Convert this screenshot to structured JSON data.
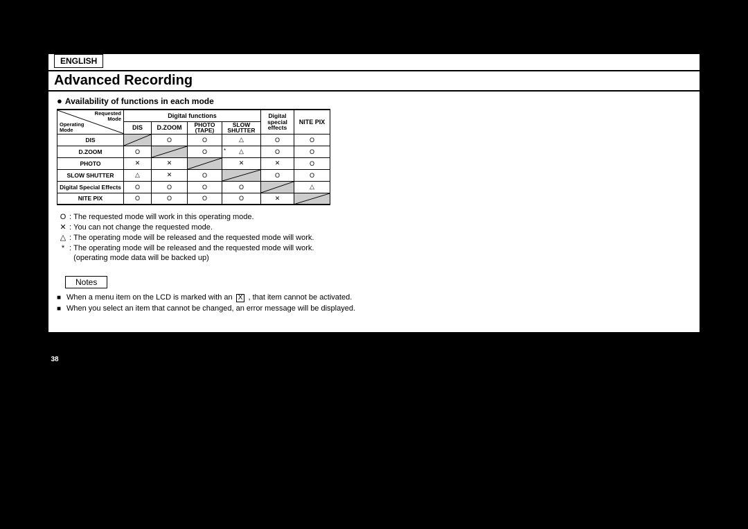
{
  "lang": "ENGLISH",
  "title": "Advanced Recording",
  "subhead": "Availability of functions in each mode",
  "table": {
    "diag": {
      "topRight": "Requested\nMode",
      "bottomLeft": "Operating\nMode"
    },
    "groupDigital": "Digital functions",
    "cols": {
      "dis": "DIS",
      "dzoom": "D.ZOOM",
      "photo1": "PHOTO",
      "photo2": "(TAPE)",
      "slow1": "SLOW",
      "slow2": "SHUTTER",
      "dse1": "Digital",
      "dse2": "special",
      "dse3": "effects",
      "nite": "NITE PIX"
    },
    "rowLabels": [
      "DIS",
      "D.ZOOM",
      "PHOTO",
      "SLOW SHUTTER",
      "Digital Special Effects",
      "NITE PIX"
    ]
  },
  "chart_data": {
    "type": "table",
    "title": "Availability of functions in each mode",
    "columns": [
      "DIS",
      "D.ZOOM",
      "PHOTO (TAPE)",
      "SLOW SHUTTER",
      "Digital special effects",
      "NITE PIX"
    ],
    "rows": [
      "DIS",
      "D.ZOOM",
      "PHOTO",
      "SLOW SHUTTER",
      "Digital Special Effects",
      "NITE PIX"
    ],
    "values": [
      [
        "self",
        "O",
        "O",
        "△",
        "O",
        "O"
      ],
      [
        "O",
        "self",
        "O",
        "*△",
        "O",
        "O"
      ],
      [
        "✕",
        "✕",
        "self",
        "✕",
        "✕",
        "O"
      ],
      [
        "△",
        "✕",
        "O",
        "self",
        "O",
        "O"
      ],
      [
        "O",
        "O",
        "O",
        "O",
        "self",
        "△"
      ],
      [
        "O",
        "O",
        "O",
        "O",
        "✕",
        "self"
      ]
    ],
    "legend": {
      "O": "The requested mode will work in this operating mode.",
      "✕": "You can not change the requested mode.",
      "△": "The operating mode will be released and the requested mode will work.",
      "*": "The operating mode will be released and the requested mode will work. (operating mode data will be backed up)"
    }
  },
  "sym": {
    "O": "O",
    "X": "✕",
    "T": "△",
    "star": "*"
  },
  "legend": {
    "o": "The requested mode will work in this operating mode.",
    "x": "You can not change the requested mode.",
    "t": "The operating mode will be released and the requested mode will work.",
    "s1": "The operating mode will be released and the requested mode will work.",
    "s2": "(operating mode data will be backed up)"
  },
  "notesLabel": "Notes",
  "notes": {
    "n1a": "When a menu item on the LCD is marked with an ",
    "n1x": "X",
    "n1b": " , that item cannot be activated.",
    "n2": "When you select an item that cannot be changed, an error message will be displayed."
  },
  "pageNum": "38"
}
